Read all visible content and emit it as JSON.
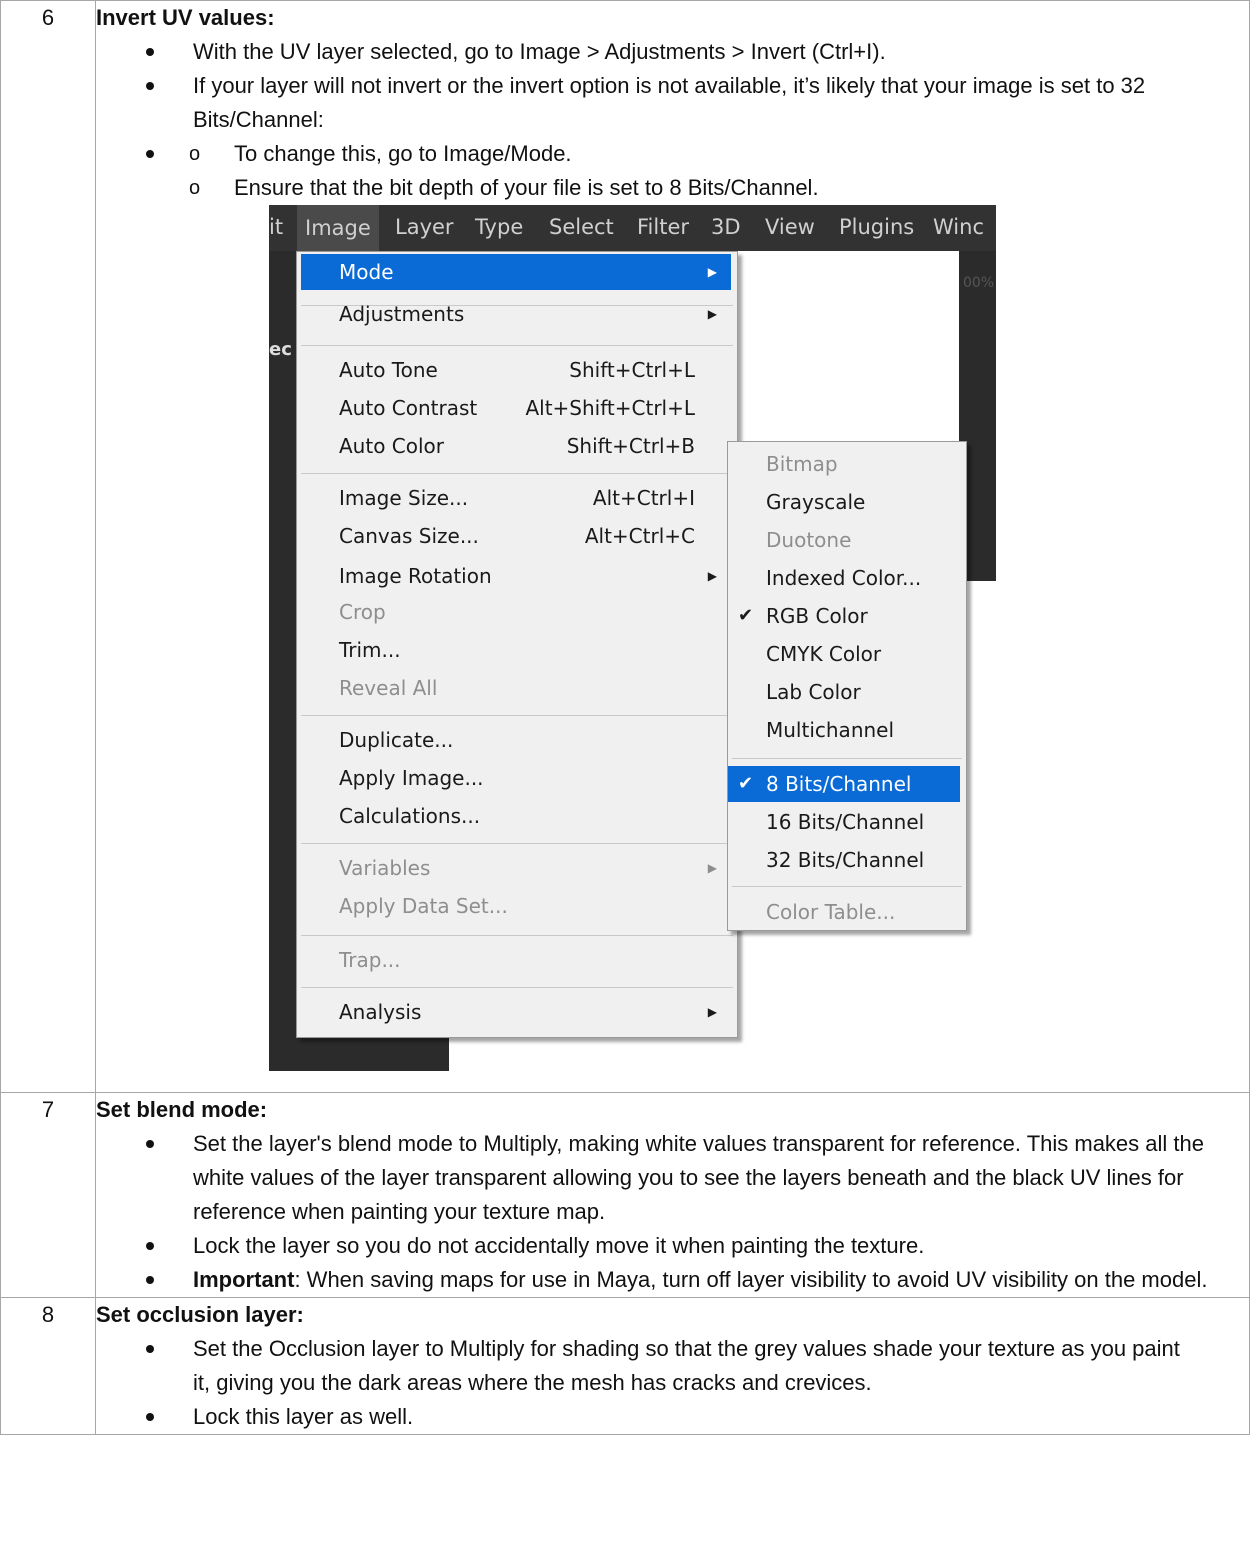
{
  "steps": [
    {
      "number": "6",
      "title": "Invert UV values:",
      "bullets": [
        "With the UV layer selected, go to Image > Adjustments > Invert (Ctrl+I).",
        "If your layer will not invert or the invert option is not available, it’s likely that your image is set to 32 Bits/Channel:"
      ],
      "sub_bullets": [
        "To change this, go to Image/Mode.",
        "Ensure that the bit depth of your file is set to 8 Bits/Channel."
      ]
    },
    {
      "number": "7",
      "title": "Set blend mode:",
      "bullets": [
        "Set the layer's blend mode to Multiply, making white values transparent for reference. This makes all the white values of the layer transparent allowing you to see the layers beneath and the black UV lines for reference when painting your texture map.",
        "Lock the layer so you do not accidentally move it when painting the texture."
      ],
      "important_label": "Important",
      "important_text": ": When saving maps for use in Maya, turn off layer visibility to avoid UV visibility on the model."
    },
    {
      "number": "8",
      "title": "Set occlusion layer:",
      "bullets": [
        "Set the Occlusion layer to Multiply for shading so that the grey values shade your texture as you paint it, giving you the dark areas where the mesh has cracks and crevices.",
        "Lock this layer as well."
      ]
    }
  ],
  "screenshot": {
    "menubar": [
      "it",
      "Image",
      "Layer",
      "Type",
      "Select",
      "Filter",
      "3D",
      "View",
      "Plugins",
      "Winc"
    ],
    "fragments": {
      "left_edge": "ec",
      "zoom": "00%"
    },
    "image_menu": [
      {
        "label": "Mode",
        "shortcut": "",
        "arrow": true,
        "state": "highlighted"
      },
      {
        "label": "Adjustments",
        "shortcut": "",
        "arrow": true,
        "state": "normal"
      },
      {
        "label": "Auto Tone",
        "shortcut": "Shift+Ctrl+L",
        "arrow": false,
        "state": "normal"
      },
      {
        "label": "Auto Contrast",
        "shortcut": "Alt+Shift+Ctrl+L",
        "arrow": false,
        "state": "normal"
      },
      {
        "label": "Auto Color",
        "shortcut": "Shift+Ctrl+B",
        "arrow": false,
        "state": "normal"
      },
      {
        "label": "Image Size...",
        "shortcut": "Alt+Ctrl+I",
        "arrow": false,
        "state": "normal"
      },
      {
        "label": "Canvas Size...",
        "shortcut": "Alt+Ctrl+C",
        "arrow": false,
        "state": "normal"
      },
      {
        "label": "Image Rotation",
        "shortcut": "",
        "arrow": true,
        "state": "normal"
      },
      {
        "label": "Crop",
        "shortcut": "",
        "arrow": false,
        "state": "disabled"
      },
      {
        "label": "Trim...",
        "shortcut": "",
        "arrow": false,
        "state": "normal"
      },
      {
        "label": "Reveal All",
        "shortcut": "",
        "arrow": false,
        "state": "disabled"
      },
      {
        "label": "Duplicate...",
        "shortcut": "",
        "arrow": false,
        "state": "normal"
      },
      {
        "label": "Apply Image...",
        "shortcut": "",
        "arrow": false,
        "state": "normal"
      },
      {
        "label": "Calculations...",
        "shortcut": "",
        "arrow": false,
        "state": "normal"
      },
      {
        "label": "Variables",
        "shortcut": "",
        "arrow": true,
        "state": "disabled"
      },
      {
        "label": "Apply Data Set...",
        "shortcut": "",
        "arrow": false,
        "state": "disabled"
      },
      {
        "label": "Trap...",
        "shortcut": "",
        "arrow": false,
        "state": "disabled"
      },
      {
        "label": "Analysis",
        "shortcut": "",
        "arrow": true,
        "state": "normal"
      }
    ],
    "mode_submenu": [
      {
        "label": "Bitmap",
        "checked": false,
        "state": "disabled"
      },
      {
        "label": "Grayscale",
        "checked": false,
        "state": "normal"
      },
      {
        "label": "Duotone",
        "checked": false,
        "state": "disabled"
      },
      {
        "label": "Indexed Color...",
        "checked": false,
        "state": "normal"
      },
      {
        "label": "RGB Color",
        "checked": true,
        "state": "normal"
      },
      {
        "label": "CMYK Color",
        "checked": false,
        "state": "normal"
      },
      {
        "label": "Lab Color",
        "checked": false,
        "state": "normal"
      },
      {
        "label": "Multichannel",
        "checked": false,
        "state": "normal"
      },
      {
        "label": "8 Bits/Channel",
        "checked": true,
        "state": "highlighted"
      },
      {
        "label": "16 Bits/Channel",
        "checked": false,
        "state": "normal"
      },
      {
        "label": "32 Bits/Channel",
        "checked": false,
        "state": "normal"
      },
      {
        "label": "Color Table...",
        "checked": false,
        "state": "disabled"
      }
    ],
    "check_glyph": "✔",
    "arrow_glyph": "▶",
    "colors": {
      "highlight": "#0a6ad6",
      "menu_bg": "#f0f0f0",
      "app_dark": "#323232"
    }
  }
}
